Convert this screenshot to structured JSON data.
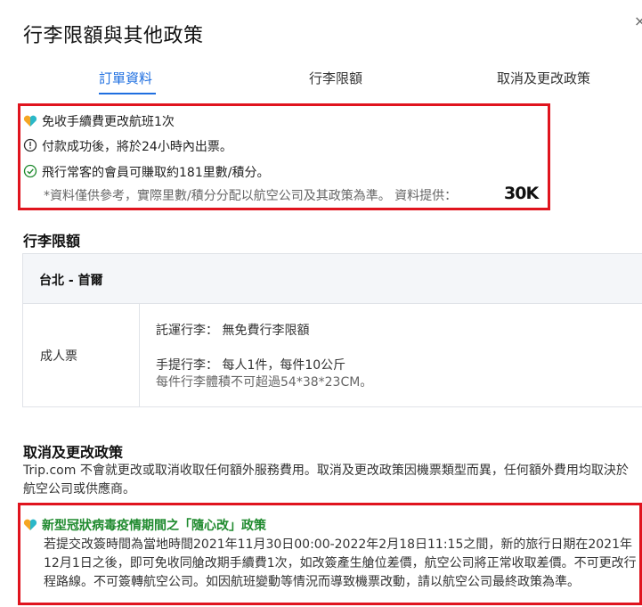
{
  "header": {
    "title": "行李限額與其他政策",
    "close_glyph": "×"
  },
  "tabs": [
    {
      "label": "訂單資料",
      "active": true
    },
    {
      "label": "行李限額",
      "active": false
    },
    {
      "label": "取消及更改政策",
      "active": false
    }
  ],
  "highlights": {
    "items": [
      {
        "icon": "heart-icon",
        "text": "免收手續費更改航班1次"
      },
      {
        "icon": "info-circle-icon",
        "text": "付款成功後，將於24小時內出票。"
      },
      {
        "icon": "check-circle-icon",
        "text": "飛行常客的會員可賺取約181里數/積分。"
      }
    ],
    "note": "*資料僅供參考，實際里數/積分分配以航空公司及其政策為準。 資料提供：",
    "provider_logo_text": "30K"
  },
  "baggage": {
    "heading": "行李限額",
    "route": "台北 - 首爾",
    "passenger_type": "成人票",
    "checked": "託運行李： 無免費行李限額",
    "carry_on": "手提行李： 每人1件，每件10公斤",
    "carry_on_note": "每件行李體積不可超過54*38*23CM。"
  },
  "cancellation": {
    "heading": "取消及更改政策",
    "description": "Trip.com 不會就更改或取消收取任何額外服務費用。取消及更改政策因機票類型而異，任何額外費用均取決於航空公司或供應商。",
    "policy_title": "新型冠狀病毒疫情期間之「隨心改」政策",
    "policy_body": "若提交改簽時間為當地時間2021年11月30日00:00-2022年2月18日11:15之間，新的旅行日期在2021年12月1日之後，即可免收同艙改期手續費1次，如改簽產生艙位差價，航空公司將正常收取差價。不可更改行程路線。不可簽轉航空公司。如因航班變動等情況而導致機票改動，請以航空公司最終政策為準。"
  },
  "colors": {
    "accent": "#1f6fe0",
    "highlight_border": "#e0141e",
    "policy_green": "#1f8a2e",
    "heart_orange": "#f5a623",
    "heart_teal": "#2bb8c9"
  }
}
